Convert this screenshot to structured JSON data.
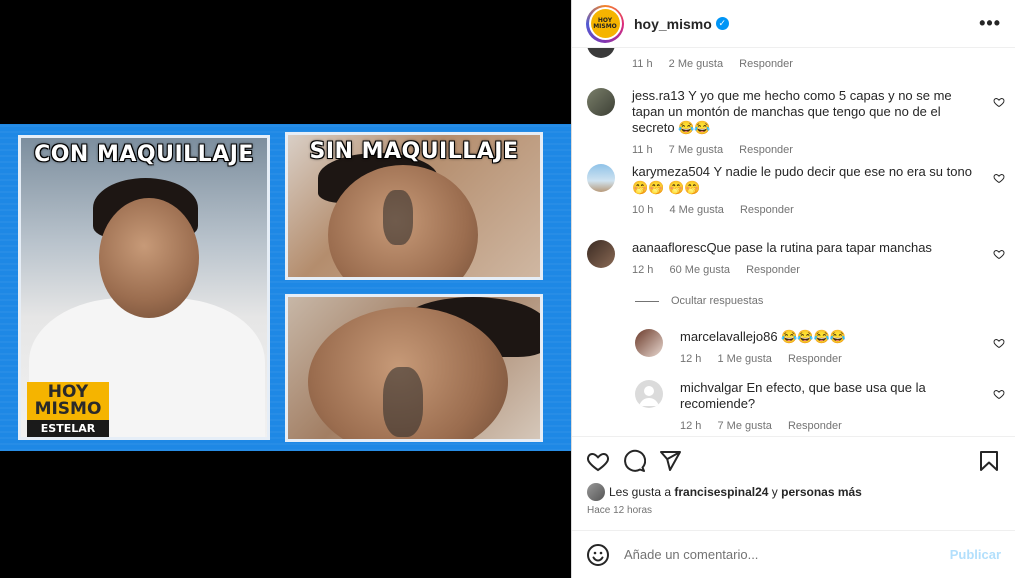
{
  "post": {
    "username": "hoy_mismo",
    "avatar_text": "HOY MISMO",
    "more_label": "•••"
  },
  "media": {
    "caption_left": "CON MAQUILLAJE",
    "caption_right": "SIN MAQUILLAJE",
    "badge_top": "HOY MISMO",
    "badge_bottom": "ESTELAR"
  },
  "comments": [
    {
      "user": "",
      "text": "",
      "time": "11 h",
      "likes": "2 Me gusta",
      "reply": "Responder"
    },
    {
      "user": "jess.ra13",
      "text": "Y yo que me hecho como 5 capas y no se me tapan un montón de manchas que tengo que no de el secreto 😂😂",
      "time": "11 h",
      "likes": "7 Me gusta",
      "reply": "Responder"
    },
    {
      "user": "karymeza504",
      "text": "Y nadie le pudo decir que ese no era su tono 🤭🤭 🤭🤭",
      "time": "10 h",
      "likes": "4 Me gusta",
      "reply": "Responder"
    },
    {
      "user": "aanaaflorescQue",
      "text": "pase la rutina para tapar manchas",
      "time": "12 h",
      "likes": "60 Me gusta",
      "reply": "Responder"
    },
    {
      "user": "marcelavallejo86",
      "text": "😂😂😂😂",
      "time": "12 h",
      "likes": "1 Me gusta",
      "reply": "Responder"
    },
    {
      "user": "michvalgar",
      "text": "En efecto, que base usa que la recomiende?",
      "time": "12 h",
      "likes": "7 Me gusta",
      "reply": "Responder"
    }
  ],
  "hide_replies": "Ocultar respuestas",
  "likes_line": {
    "prefix": "Les gusta a",
    "user": "francisespinal24",
    "middle": "y",
    "suffix": "personas más"
  },
  "post_time": "Hace 12 horas",
  "add_comment": {
    "placeholder": "Añade un comentario...",
    "publish": "Publicar"
  },
  "colors": {
    "accent": "#0095f6",
    "publish_disabled": "#b2dffc",
    "badge_yellow": "#f5b400",
    "frame_blue": "#1e88e5"
  }
}
